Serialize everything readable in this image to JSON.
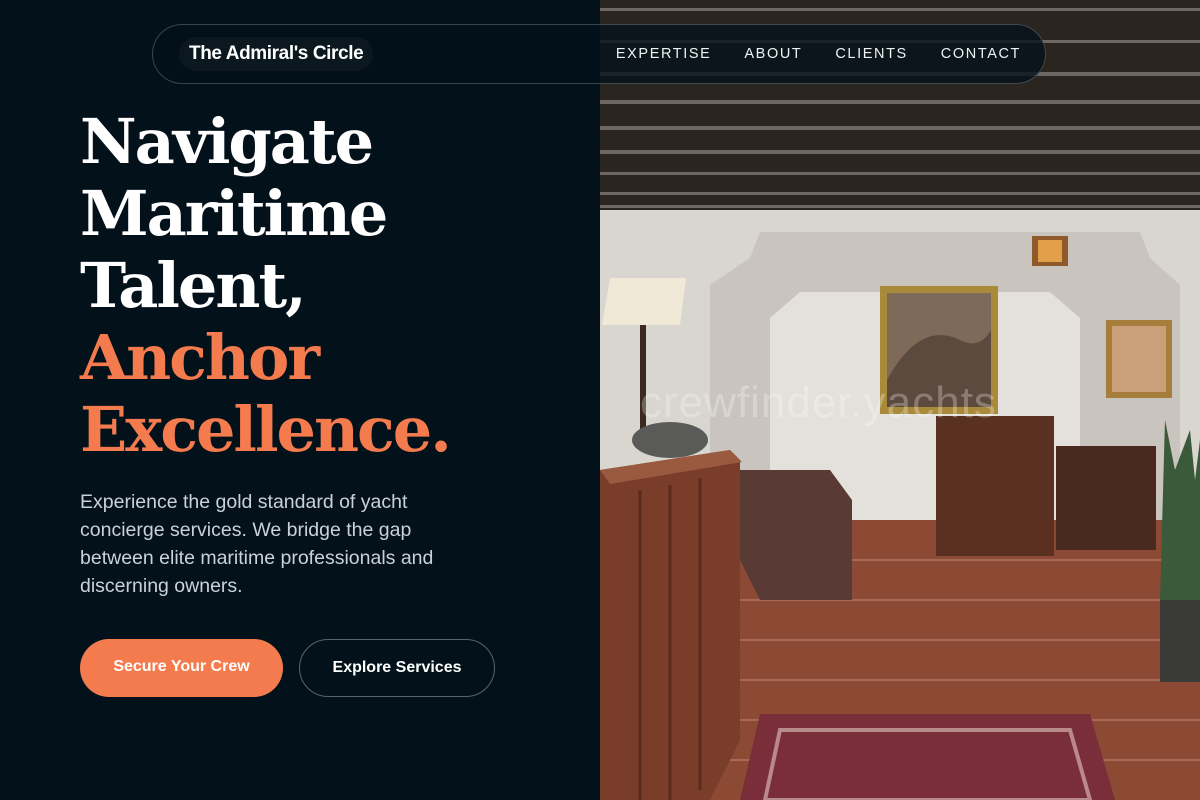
{
  "brand": {
    "name": "The Admiral's Circle"
  },
  "nav": {
    "links": [
      "EXPERTISE",
      "ABOUT",
      "CLIENTS",
      "CONTACT"
    ]
  },
  "hero": {
    "headline_white": [
      "Navigate",
      "Maritime",
      "Talent,"
    ],
    "headline_accent": [
      "Anchor",
      "Excellence."
    ],
    "description": "Experience the gold standard of yacht concierge services. We bridge the gap between elite maritime professionals and discerning owners.",
    "primary_cta": "Secure Your Crew",
    "secondary_cta": "Explore Services",
    "image_watermark": "crewfinder.yachts"
  },
  "colors": {
    "background": "#03111a",
    "accent": "#f47b4e",
    "text": "#ffffff",
    "muted_text": "#c9d2d8"
  }
}
